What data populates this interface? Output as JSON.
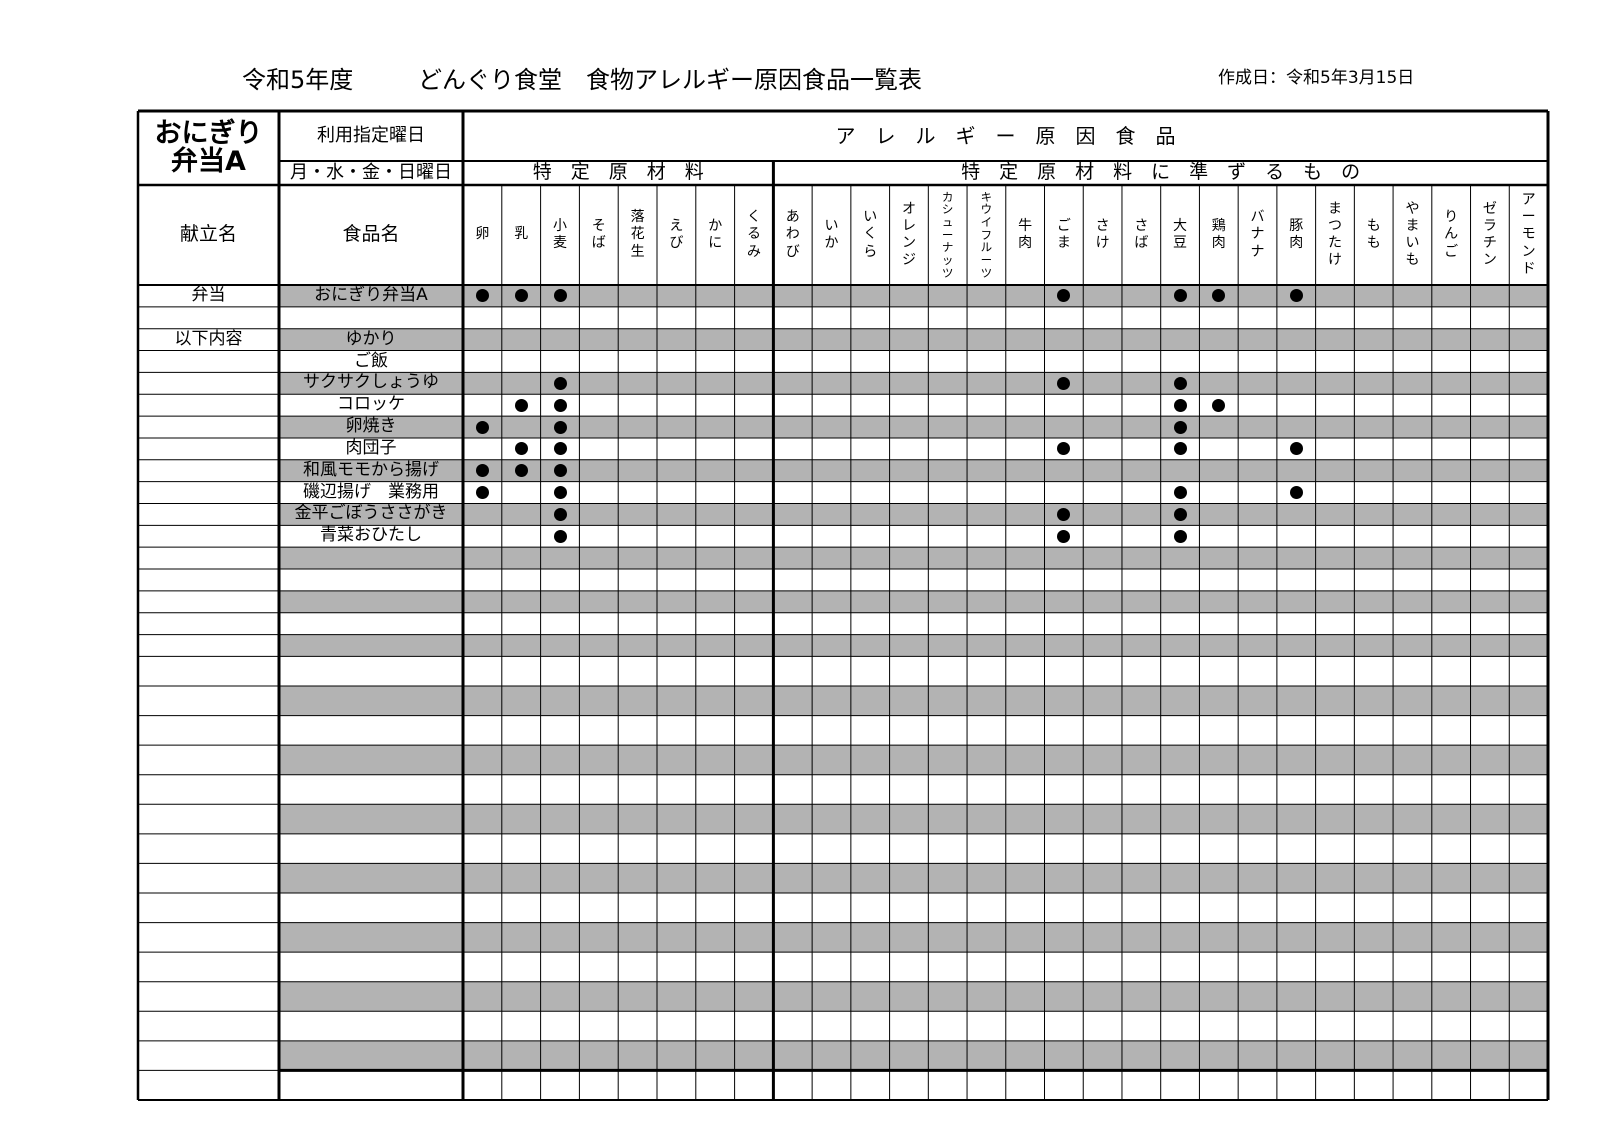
{
  "header": {
    "fiscal_year": "令和5年度",
    "title": "どんぐり食堂　食物アレルギー原因食品一覧表",
    "created_date": "作成日：令和5年3月15日"
  },
  "table": {
    "menu_title_line1": "おにぎり",
    "menu_title_line2": "弁当A",
    "usage_day_label": "利用指定曜日",
    "usage_days": "月・水・金・日曜日",
    "allergen_header": "ア　レ　ル　ギ　ー　原　因　食　品",
    "group_specified": "特　定　原　材　料",
    "group_equivalent": "特　定　原　材　料　に　準　ず　る　も　の",
    "col_menu_name": "献立名",
    "col_food_name": "食品名",
    "allergens": [
      "卵",
      "乳",
      "小麦",
      "そば",
      "落花生",
      "えび",
      "かに",
      "くるみ",
      "あわび",
      "いか",
      "いくら",
      "オレンジ",
      "カシューナッツ",
      "キウイフルーツ",
      "牛肉",
      "ごま",
      "さけ",
      "さば",
      "大豆",
      "鶏肉",
      "バナナ",
      "豚肉",
      "まつたけ",
      "もも",
      "やまいも",
      "りんご",
      "ゼラチン",
      "アーモンド"
    ],
    "rows": [
      {
        "menu": "弁当",
        "food": "おにぎり弁当A",
        "marks": [
          0,
          1,
          2,
          15,
          18,
          19,
          21
        ]
      },
      {
        "menu": "",
        "food": "",
        "marks": []
      },
      {
        "menu": "以下内容",
        "food": "ゆかり",
        "marks": []
      },
      {
        "menu": "",
        "food": "ご飯",
        "marks": []
      },
      {
        "menu": "",
        "food": "サクサクしょうゆ",
        "marks": [
          2,
          15,
          18
        ]
      },
      {
        "menu": "",
        "food": "コロッケ",
        "marks": [
          1,
          2,
          18,
          19
        ]
      },
      {
        "menu": "",
        "food": "卵焼き",
        "marks": [
          0,
          2,
          18
        ]
      },
      {
        "menu": "",
        "food": "肉団子",
        "marks": [
          1,
          2,
          15,
          18,
          21
        ]
      },
      {
        "menu": "",
        "food": "和風モモから揚げ",
        "marks": [
          0,
          1,
          2
        ]
      },
      {
        "menu": "",
        "food": "磯辺揚げ　業務用",
        "marks": [
          0,
          2,
          18,
          21
        ]
      },
      {
        "menu": "",
        "food": "金平ごぼうささがき",
        "marks": [
          2,
          15,
          18
        ]
      },
      {
        "menu": "",
        "food": "青菜おひたし",
        "marks": [
          2,
          15,
          18
        ]
      }
    ],
    "empty_row_count": 20,
    "mark_symbol": "●",
    "shade_color": "#b3b3b3"
  }
}
